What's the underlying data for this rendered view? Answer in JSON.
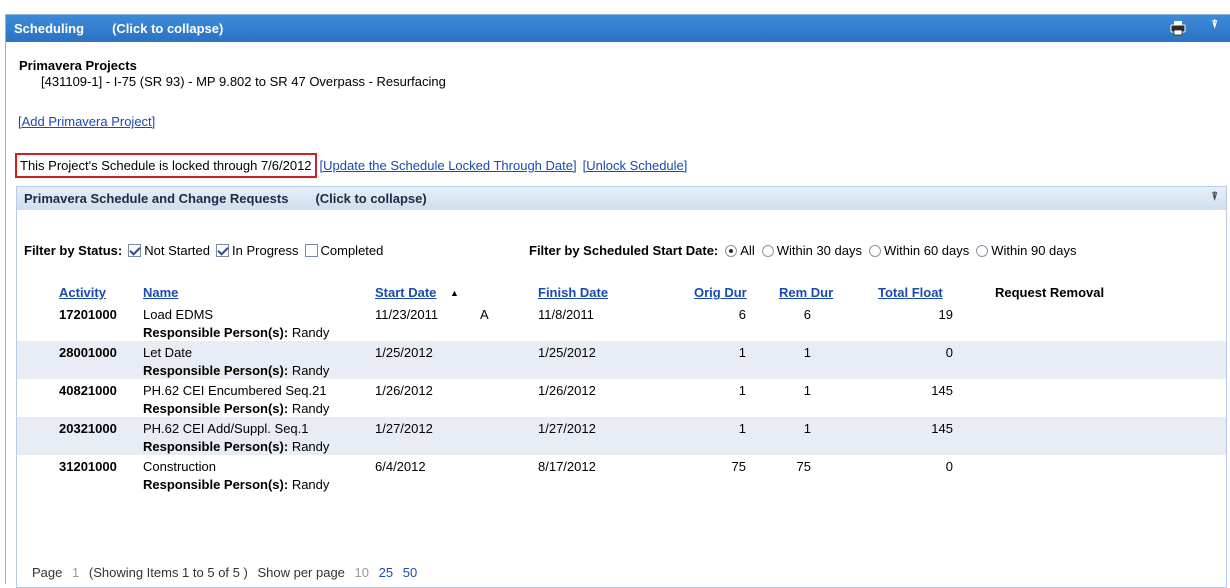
{
  "header": {
    "title": "Scheduling",
    "collapse": "(Click to collapse)",
    "pin": "⍒"
  },
  "projects": {
    "label": "Primavera Projects",
    "item": "[431109-1] - I-75 (SR 93) - MP 9.802 to SR 47 Overpass - Resurfacing",
    "add_link": "[Add Primavera Project]"
  },
  "lock": {
    "message": "This Project's Schedule is locked through 7/6/2012",
    "update_link": "[Update the Schedule Locked Through Date]",
    "unlock_link": "[Unlock Schedule]"
  },
  "panel": {
    "title": "Primavera Schedule and Change Requests",
    "collapse": "(Click to collapse)",
    "pin": "⍒"
  },
  "filters": {
    "status_label": "Filter by Status:",
    "status_options": [
      {
        "label": "Not Started",
        "checked": true
      },
      {
        "label": "In Progress",
        "checked": true
      },
      {
        "label": "Completed",
        "checked": false
      }
    ],
    "date_label": "Filter by Scheduled Start Date:",
    "date_options": [
      {
        "label": "All",
        "selected": true
      },
      {
        "label": "Within 30 days",
        "selected": false
      },
      {
        "label": "Within 60 days",
        "selected": false
      },
      {
        "label": "Within 90 days",
        "selected": false
      }
    ]
  },
  "table": {
    "columns": {
      "activity": "Activity",
      "name": "Name",
      "start": "Start Date",
      "sort_icon": "▲",
      "finish": "Finish Date",
      "orig": "Orig Dur",
      "rem": "Rem Dur",
      "float": "Total Float",
      "removal": "Request Removal"
    },
    "responsible_label": "Responsible Person(s):",
    "rows": [
      {
        "activity": "17201000",
        "name": "Load EDMS",
        "start": "11/23/2011",
        "flag": "A",
        "finish": "11/8/2011",
        "orig": "6",
        "rem": "6",
        "float": "19",
        "person": " Randy"
      },
      {
        "activity": "28001000",
        "name": "Let Date",
        "start": "1/25/2012",
        "flag": "",
        "finish": "1/25/2012",
        "orig": "1",
        "rem": "1",
        "float": "0",
        "person": " Randy"
      },
      {
        "activity": "40821000",
        "name": "PH.62 CEI Encumbered Seq.21",
        "start": "1/26/2012",
        "flag": "",
        "finish": "1/26/2012",
        "orig": "1",
        "rem": "1",
        "float": "145",
        "person": " Randy"
      },
      {
        "activity": "20321000",
        "name": "PH.62 CEI Add/Suppl. Seq.1",
        "start": "1/27/2012",
        "flag": "",
        "finish": "1/27/2012",
        "orig": "1",
        "rem": "1",
        "float": "145",
        "person": " Randy"
      },
      {
        "activity": "31201000",
        "name": "Construction",
        "start": "6/4/2012",
        "flag": "",
        "finish": "8/17/2012",
        "orig": "75",
        "rem": "75",
        "float": "0",
        "person": " Randy"
      }
    ]
  },
  "pager": {
    "page_label": "Page",
    "page": "1",
    "showing": "(Showing Items 1 to 5 of 5 )",
    "per_page_label": "Show per page",
    "sizes": [
      "10",
      "25",
      "50"
    ],
    "current_size": "10"
  }
}
